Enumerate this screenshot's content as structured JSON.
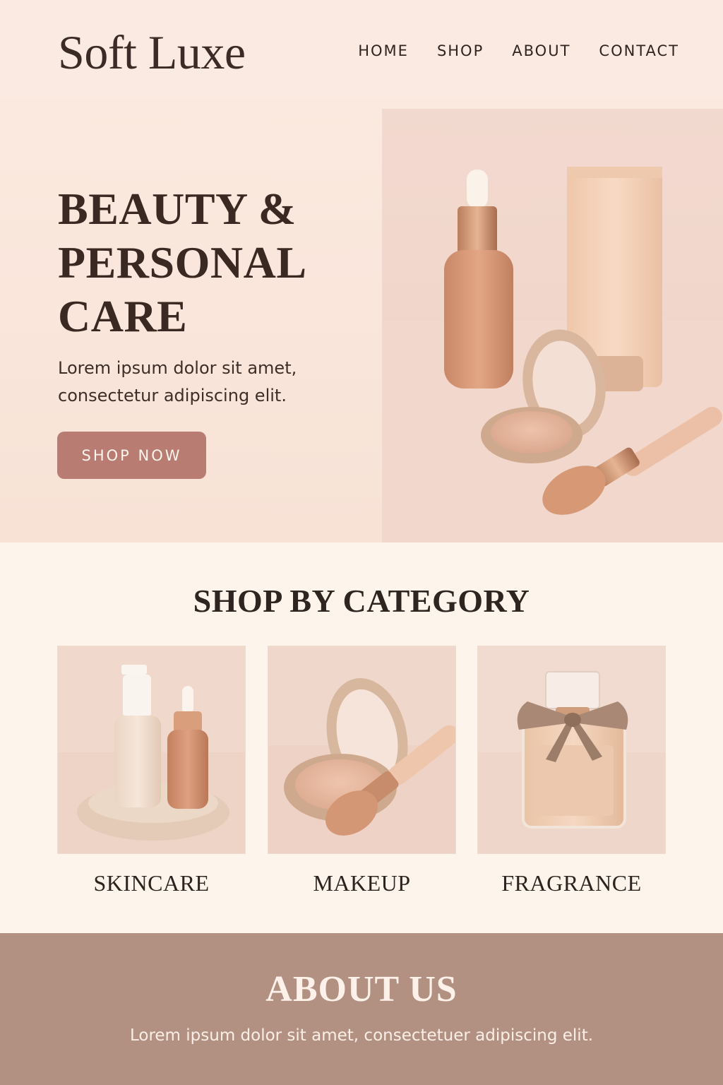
{
  "brand": {
    "logo": "Soft Luxe"
  },
  "nav": {
    "items": [
      "HOME",
      "SHOP",
      "ABOUT",
      "CONTACT"
    ]
  },
  "hero": {
    "title_lines": [
      "BEAUTY &",
      "PERSONAL",
      "CARE"
    ],
    "text_lines": [
      "Lorem ipsum dolor sit amet,",
      "consectetur adipiscing elit."
    ],
    "cta_label": "SHOP NOW",
    "image": "beauty-products-photo"
  },
  "categories": {
    "title": "SHOP BY CATEGORY",
    "items": [
      {
        "label": "SKINCARE",
        "image": "skincare-bottles-photo"
      },
      {
        "label": "MAKEUP",
        "image": "makeup-compact-brush-photo"
      },
      {
        "label": "FRAGRANCE",
        "image": "perfume-bottle-photo"
      }
    ]
  },
  "about": {
    "title": "ABOUT US",
    "text": "Lorem ipsum dolor sit amet, consectetuer adipiscing elit."
  },
  "colors": {
    "page_bg": "#fbeee4",
    "accent_button": "#b87c72",
    "about_bg": "#b29183",
    "text_dark": "#3a2a25"
  }
}
